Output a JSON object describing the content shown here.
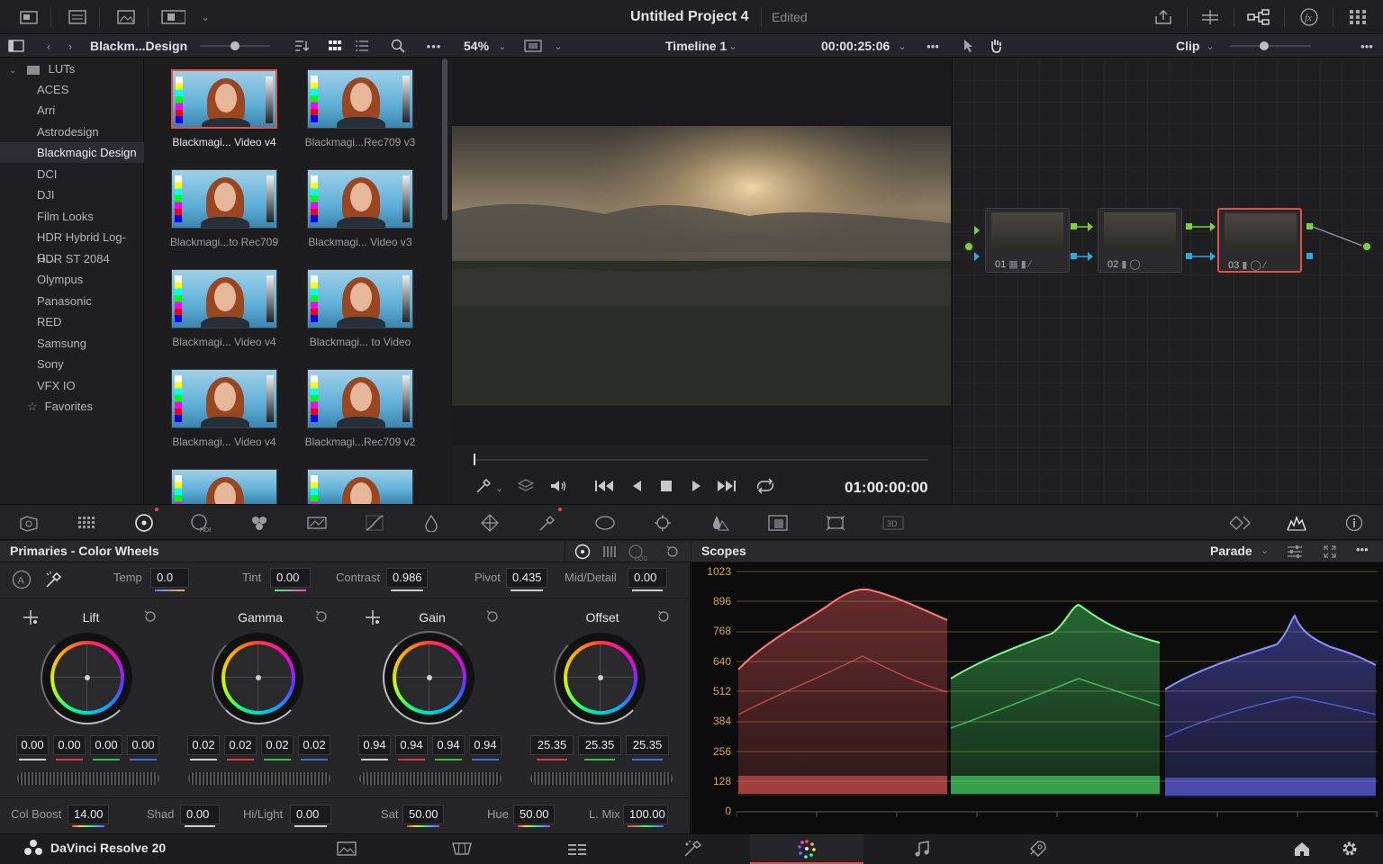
{
  "window": {
    "project_title": "Untitled Project 4",
    "project_status": "Edited"
  },
  "media": {
    "folder_path": "Blackm...Design",
    "tree_root": "LUTs",
    "tree_items": [
      "ACES",
      "Arri",
      "Astrodesign",
      "Blackmagic Design",
      "DCI",
      "DJI",
      "Film Looks",
      "HDR Hybrid Log-G...",
      "HDR ST 2084",
      "Olympus",
      "Panasonic",
      "RED",
      "Samsung",
      "Sony",
      "VFX IO"
    ],
    "selected_item": "Blackmagic Design",
    "favorites": "Favorites",
    "thumbnails": [
      "Blackmagi... Video v4",
      "Blackmagi...Rec709 v3",
      "Blackmagi...to Rec709",
      "Blackmagi... Video v3",
      "Blackmagi... Video v4",
      "Blackmagi... to Video",
      "Blackmagi... Video v4",
      "Blackmagi...Rec709 v2"
    ]
  },
  "viewer": {
    "zoom": "54%",
    "timeline": "Timeline 1",
    "duration": "00:00:25:06",
    "timecode": "01:00:00:00"
  },
  "nodes": {
    "mode": "Clip",
    "labels": [
      "01",
      "02",
      "03"
    ]
  },
  "primaries": {
    "title": "Primaries - Color Wheels",
    "temp_label": "Temp",
    "temp": "0.0",
    "tint_label": "Tint",
    "tint": "0.00",
    "contrast_label": "Contrast",
    "contrast": "0.986",
    "pivot_label": "Pivot",
    "pivot": "0.435",
    "middetail_label": "Mid/Detail",
    "middetail": "0.00",
    "wheels": [
      {
        "name": "Lift",
        "values": [
          "0.00",
          "0.00",
          "0.00",
          "0.00"
        ]
      },
      {
        "name": "Gamma",
        "values": [
          "0.02",
          "0.02",
          "0.02",
          "0.02"
        ]
      },
      {
        "name": "Gain",
        "values": [
          "0.94",
          "0.94",
          "0.94",
          "0.94"
        ]
      },
      {
        "name": "Offset",
        "values": [
          "25.35",
          "25.35",
          "25.35"
        ]
      }
    ],
    "colboost_label": "Col Boost",
    "colboost": "14.00",
    "shad_label": "Shad",
    "shad": "0.00",
    "hilight_label": "Hi/Light",
    "hilight": "0.00",
    "sat_label": "Sat",
    "sat": "50.00",
    "hue_label": "Hue",
    "hue": "50.00",
    "lmix_label": "L. Mix",
    "lmix": "100.00"
  },
  "scopes": {
    "title": "Scopes",
    "mode": "Parade",
    "y_ticks": [
      "1023",
      "896",
      "768",
      "640",
      "512",
      "384",
      "256",
      "128",
      "0"
    ]
  },
  "app": {
    "name": "DaVinci Resolve 20"
  },
  "colors": {
    "accent_red": "#e05046",
    "scope_axis": "#d8a84a",
    "node_green": "#7fd13b",
    "node_blue": "#2ea8e0"
  }
}
